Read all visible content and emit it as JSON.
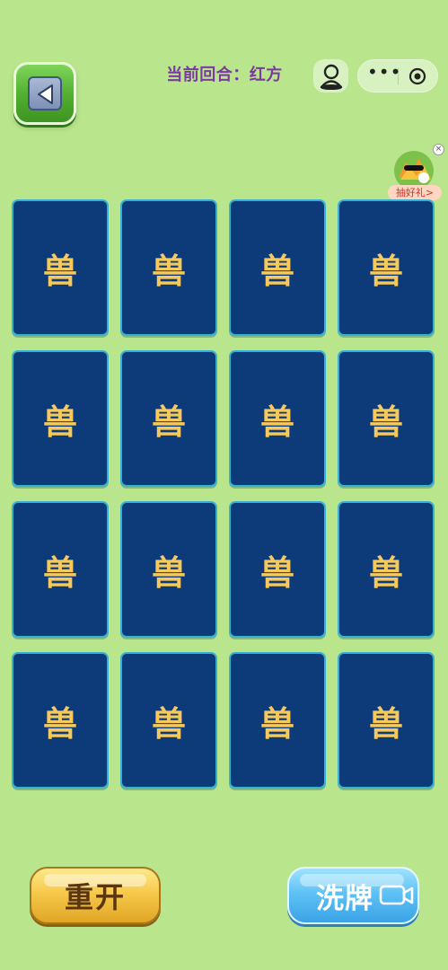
{
  "header": {
    "turn_label": "当前回合：红方"
  },
  "toolbar": {
    "more_label": "•••"
  },
  "gift": {
    "label": "抽好礼>",
    "close": "×"
  },
  "cards": [
    {
      "label": "兽"
    },
    {
      "label": "兽"
    },
    {
      "label": "兽"
    },
    {
      "label": "兽"
    },
    {
      "label": "兽"
    },
    {
      "label": "兽"
    },
    {
      "label": "兽"
    },
    {
      "label": "兽"
    },
    {
      "label": "兽"
    },
    {
      "label": "兽"
    },
    {
      "label": "兽"
    },
    {
      "label": "兽"
    },
    {
      "label": "兽"
    },
    {
      "label": "兽"
    },
    {
      "label": "兽"
    },
    {
      "label": "兽"
    }
  ],
  "buttons": {
    "restart": "重开",
    "shuffle": "洗牌"
  },
  "colors": {
    "background": "#b9e58c",
    "card_back": "#0d3b79",
    "card_text": "#f7c85a",
    "turn_text": "#7a3aa0"
  },
  "icons": {
    "back": "back-arrow-icon",
    "person": "person-icon",
    "more": "more-dots-icon",
    "target": "target-icon",
    "video": "video-camera-icon"
  }
}
